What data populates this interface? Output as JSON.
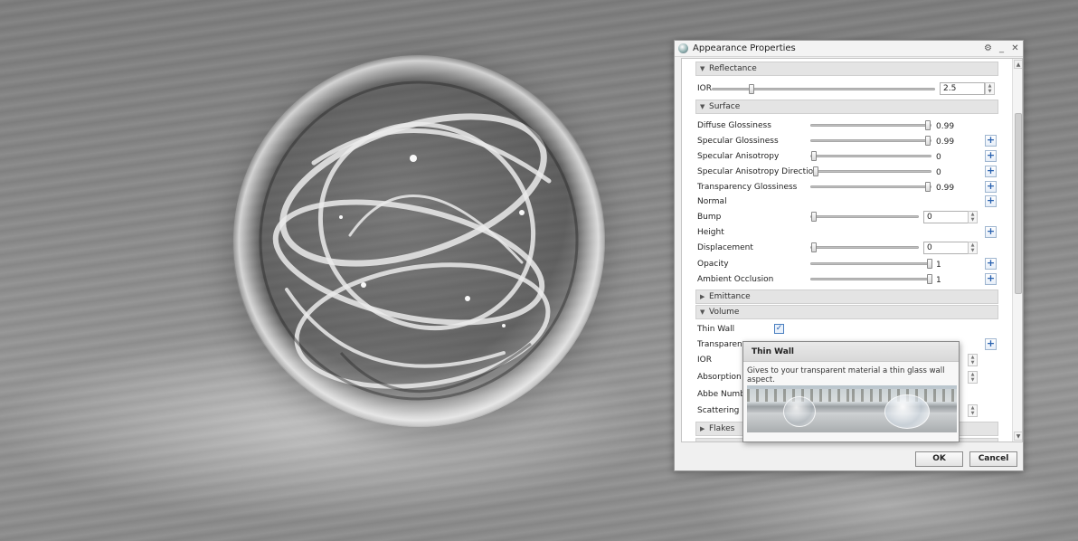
{
  "window": {
    "title": "Appearance Properties",
    "icons": [
      "gear-icon",
      "minimize-icon",
      "close-icon"
    ]
  },
  "sections": {
    "reflectance": "Reflectance",
    "surface": "Surface",
    "emittance": "Emittance",
    "volume": "Volume",
    "flakes": "Flakes"
  },
  "reflectance": {
    "ior_label": "IOR",
    "ior_value": "2.5",
    "ior_fraction": 0.17
  },
  "surface": {
    "diffuse_glossiness": {
      "label": "Diffuse Glossiness",
      "value": "0.99",
      "fraction": 0.99
    },
    "specular_glossiness": {
      "label": "Specular Glossiness",
      "value": "0.99",
      "fraction": 0.99
    },
    "specular_anisotropy": {
      "label": "Specular Anisotropy",
      "value": "0",
      "fraction": 0
    },
    "specular_anisotropy_direction": {
      "label": "Specular Anisotropy Direction",
      "value": "0",
      "fraction": 0
    },
    "transparency_glossiness": {
      "label": "Transparency Glossiness",
      "value": "0.99",
      "fraction": 0.99
    },
    "normal": {
      "label": "Normal"
    },
    "bump": {
      "label": "Bump",
      "value": "0",
      "fraction": 0
    },
    "height": {
      "label": "Height"
    },
    "displacement": {
      "label": "Displacement",
      "value": "0",
      "fraction": 0
    },
    "opacity": {
      "label": "Opacity",
      "value": "1",
      "fraction": 1
    },
    "ambient_occlusion": {
      "label": "Ambient Occlusion",
      "value": "1",
      "fraction": 1
    }
  },
  "volume": {
    "thin_wall": {
      "label": "Thin Wall",
      "checked": true
    },
    "transparency": {
      "label": "Transparency"
    },
    "ior": {
      "label": "IOR"
    },
    "absorption": {
      "label": "Absorption D"
    },
    "abbe": {
      "label": "Abbe Numb"
    },
    "scattering": {
      "label": "Scattering D"
    }
  },
  "buttons": {
    "ok": "OK",
    "cancel": "Cancel"
  },
  "tooltip": {
    "title": "Thin Wall",
    "description": "Gives to your transparent material a thin glass wall aspect."
  }
}
